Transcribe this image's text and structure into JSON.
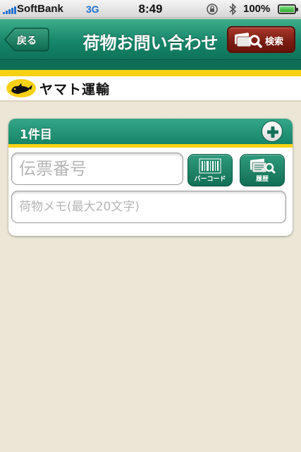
{
  "status_bar": {
    "carrier": "SoftBank",
    "network": "3G",
    "time": "8:49",
    "battery": "100%"
  },
  "nav": {
    "back_label": "戻る",
    "title": "荷物お問い合わせ",
    "search_label": "検索"
  },
  "brand": {
    "logo_text": "ヤマト運輸"
  },
  "card": {
    "title": "1件目",
    "tracking_placeholder": "伝票番号",
    "memo_placeholder": "荷物メモ(最大20文字)",
    "barcode_label": "バーコード",
    "history_label": "履歴"
  },
  "icons": {
    "rotation_lock": "rotation-lock-icon",
    "bluetooth": "bluetooth-icon",
    "battery": "battery-icon",
    "add": "plus-icon",
    "barcode": "barcode-icon",
    "history": "history-icon",
    "search": "search-icon",
    "logo": "black-cat-icon"
  },
  "colors": {
    "brand_green": "#17866a",
    "accent_yellow": "#f7d214",
    "search_red": "#7a1c12",
    "background": "#ebe6d6"
  }
}
